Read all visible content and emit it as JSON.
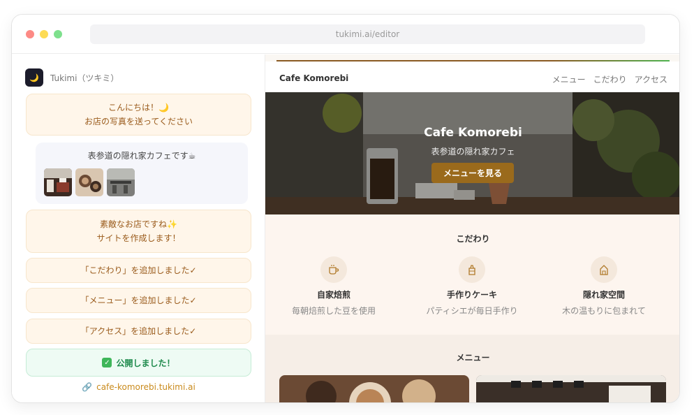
{
  "browser": {
    "url": "tukimi.ai/editor"
  },
  "app": {
    "logo_glyph": "🌙",
    "name": "Tukimi（ツキミ）"
  },
  "chat": {
    "greeting_line1": "こんにちは！🌙",
    "greeting_line2": "お店の写真を送ってください",
    "user_message": "表参道の隠れ家カフェです☕",
    "reply_line1": "素敵なお店ですね✨",
    "reply_line2": "サイトを作成します！",
    "added_1": "「こだわり」を追加しました✓",
    "added_2": "「メニュー」を追加しました✓",
    "added_3": "「アクセス」を追加しました✓",
    "published_check": "✓",
    "published": "公開しました！",
    "site_link": "cafe-komorebi.tukimi.ai"
  },
  "site": {
    "logo": "Cafe Komorebi",
    "nav": [
      "メニュー",
      "こだわり",
      "アクセス"
    ],
    "hero": {
      "title": "Cafe Komorebi",
      "subtitle": "表参道の隠れ家カフェ",
      "button": "メニューを見る"
    },
    "kodawari": {
      "title": "こだわり",
      "features": [
        {
          "icon": "coffee-cup-icon",
          "name": "自家焙煎",
          "desc": "毎朝焙煎した豆を使用"
        },
        {
          "icon": "cake-icon",
          "name": "手作りケーキ",
          "desc": "パティシエが毎日手作り"
        },
        {
          "icon": "house-icon",
          "name": "隠れ家空間",
          "desc": "木の温もりに包まれて"
        }
      ]
    },
    "menu": {
      "title": "メニュー"
    }
  },
  "colors": {
    "accent_brown": "#9a6a1c",
    "chat_bubble_bg": "#fff6ea",
    "chat_text": "#9a5b1c",
    "success_green": "#1e8a4c",
    "link_gold": "#c98a1c"
  }
}
